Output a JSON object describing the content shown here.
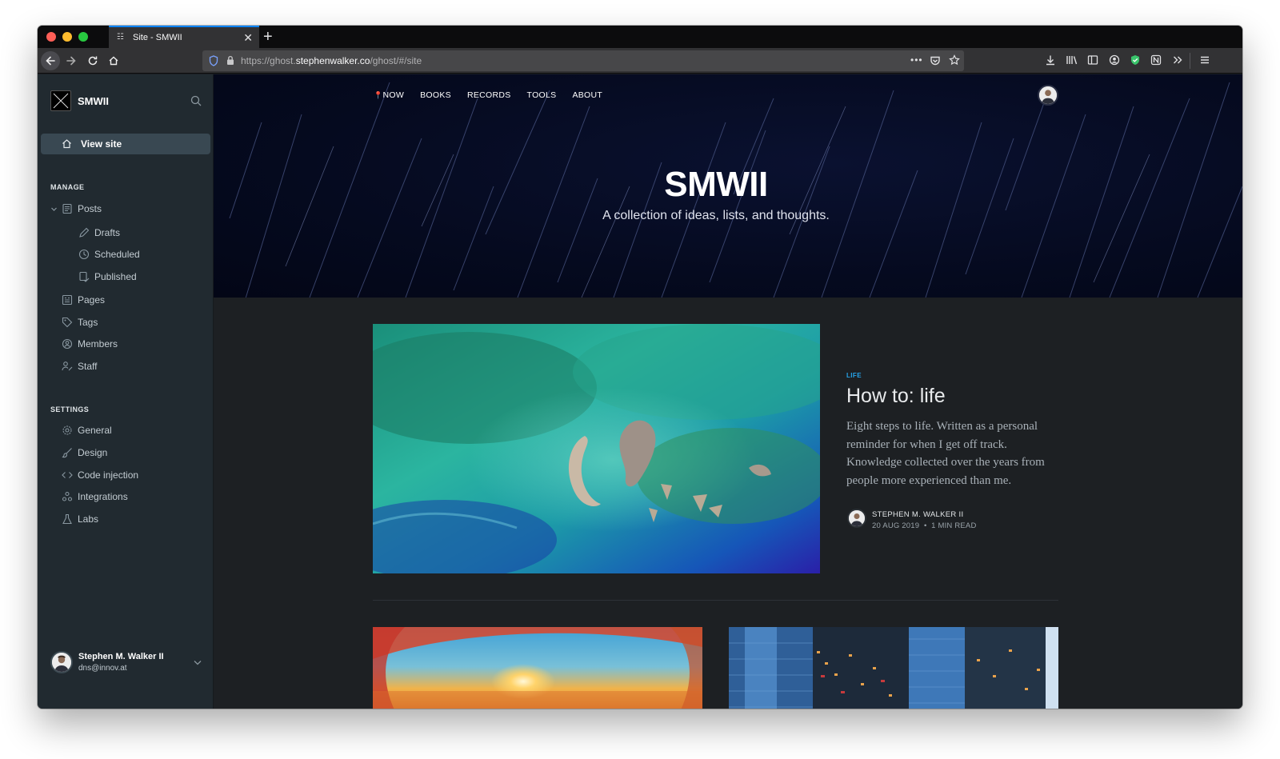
{
  "browser": {
    "tab_title": "Site - SMWII",
    "url_prefix": "https://ghost.",
    "url_domain": "stephenwalker.co",
    "url_path": "/ghost/#/site"
  },
  "sidebar": {
    "brand_name": "SMWII",
    "view_site_label": "View site",
    "manage_title": "MANAGE",
    "manage_items": [
      {
        "label": "Posts",
        "icon": "posts-icon"
      },
      {
        "label": "Drafts",
        "icon": "pencil-icon"
      },
      {
        "label": "Scheduled",
        "icon": "clock-icon"
      },
      {
        "label": "Published",
        "icon": "published-icon"
      },
      {
        "label": "Pages",
        "icon": "pages-icon"
      },
      {
        "label": "Tags",
        "icon": "tag-icon"
      },
      {
        "label": "Members",
        "icon": "members-icon"
      },
      {
        "label": "Staff",
        "icon": "staff-icon"
      }
    ],
    "settings_title": "SETTINGS",
    "settings_items": [
      {
        "label": "General",
        "icon": "gear-icon"
      },
      {
        "label": "Design",
        "icon": "brush-icon"
      },
      {
        "label": "Code injection",
        "icon": "code-icon"
      },
      {
        "label": "Integrations",
        "icon": "integrations-icon"
      },
      {
        "label": "Labs",
        "icon": "flask-icon"
      }
    ],
    "account_name": "Stephen M. Walker II",
    "account_email": "dns@innov.at"
  },
  "site": {
    "nav": [
      "NOW",
      "BOOKS",
      "RECORDS",
      "TOOLS",
      "ABOUT"
    ],
    "title": "SMWII",
    "description": "A collection of ideas, lists, and thoughts.",
    "featured": {
      "tag": "LIFE",
      "title": "How to: life",
      "excerpt": "Eight steps to life. Written as a personal reminder for when I get off track. Knowledge collected over the years from people more experienced than me.",
      "author": "STEPHEN M. WALKER II",
      "date": "20 AUG 2019",
      "separator": "•",
      "read_time": "1 MIN READ"
    }
  },
  "colors": {
    "accent": "#26a6ed",
    "sidebar_bg": "#212a30",
    "hero_bg": "#050a1f"
  }
}
